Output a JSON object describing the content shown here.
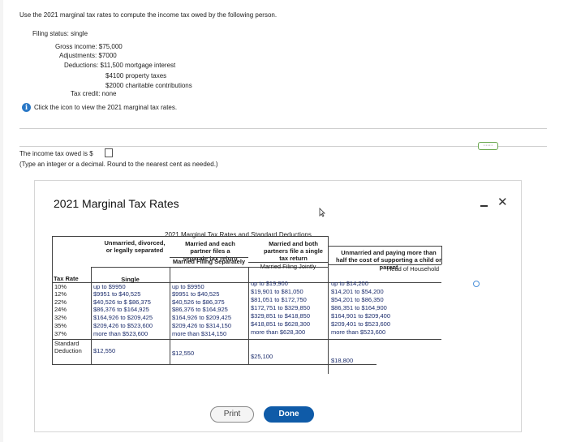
{
  "question": {
    "prompt": "Use the 2021 marginal tax rates to compute the income tax owed by the following person.",
    "filing_status": "Filing status: single",
    "gross_income": "Gross income: $75,000",
    "adjustments": "Adjustments: $7000",
    "deductions": "Deductions: $11,500 mortgage interest",
    "deduction_2": "$4100 property taxes",
    "deduction_3": "$2000 charitable contributions",
    "tax_credit": "Tax credit: none",
    "info_link": "Click the icon to view the 2021 marginal tax rates.",
    "more_label": "·····"
  },
  "answer": {
    "label": "The income tax owed is $",
    "hint": "(Type an integer or a decimal. Round to the nearest cent as needed.)"
  },
  "dialog": {
    "title": "2021 Marginal Tax Rates",
    "minimize": "—",
    "close": "✕",
    "table_title": "2021 Marginal Tax Rates and Standard Deductions",
    "headers": {
      "single_group": "Unmarried, divorced, or legally separated",
      "mfs_group": "Married and each partner files a separate tax return",
      "mfj_group": "Married and both partners file a single tax return",
      "hoh_group": "Unmarried and paying more than half the cost of supporting a child or parent",
      "tax_rate": "Tax Rate",
      "single": "Single",
      "mfs": "Married Filing Separately",
      "mfj": "Married Filing Jointly",
      "hoh": "Head of Household"
    },
    "rates": [
      "10%",
      "12%",
      "22%",
      "24%",
      "32%",
      "35%",
      "37%"
    ],
    "single": [
      "up to $9950",
      "$9951 to $40,525",
      "$40,526 to $ $86,375",
      "$86,376 to $164,925",
      "$164,926 to $209,425",
      "$209,426 to $523,600",
      "more than $523,600"
    ],
    "mfs": [
      "up to $9950",
      "$9951 to $40,525",
      "$40,526 to $86,375",
      "$86,376 to $164,925",
      "$164,926 to $209,425",
      "$209,426 to $314,150",
      "more than $314,150"
    ],
    "mfj": [
      "up to $19,900",
      "$19,901 to $81,050",
      "$81,051 to $172,750",
      "$172,751 to $329,850",
      "$329,851 to $418,850",
      "$418,851 to $628,300",
      "more than $628,300"
    ],
    "hoh": [
      "up to $14,200",
      "$14,201 to $54,200",
      "$54,201 to $86,350",
      "$86,351 to $164,900",
      "$164,901 to $209,400",
      "$209,401 to $523,600",
      "more than $523,600"
    ],
    "standard_label": "Standard",
    "deduction_label": "Deduction",
    "std_single": "$12,550",
    "std_mfs": "$12,550",
    "std_mfj": "$25,100",
    "std_hoh": "$18,800",
    "print": "Print",
    "done": "Done"
  }
}
